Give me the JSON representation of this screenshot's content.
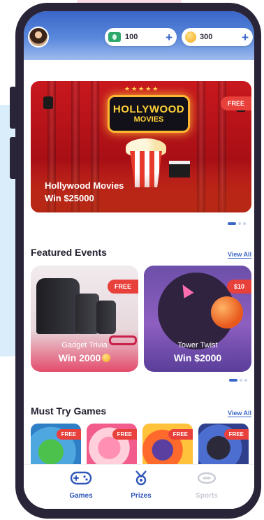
{
  "header": {
    "cash_balance": "100",
    "coin_balance": "300",
    "add_label": "+"
  },
  "banner": {
    "marquee_line1": "HOLLYWOOD",
    "marquee_line2": "MOVIES",
    "stars": "★★★★★",
    "tag": "FREE",
    "title": "Hollywood Movies",
    "prize": "Win $25000"
  },
  "featured": {
    "title": "Featured Events",
    "view_all": "View All",
    "events": [
      {
        "tag": "FREE",
        "name": "Gadget Trivia",
        "prize": "Win 2000"
      },
      {
        "tag": "$10",
        "name": "Tower Twist",
        "prize": "Win $2000"
      }
    ]
  },
  "must_try": {
    "title": "Must Try Games",
    "view_all": "View All",
    "games": [
      {
        "tag": "FREE"
      },
      {
        "tag": "FREE"
      },
      {
        "tag": "FREE"
      },
      {
        "tag": "FREE"
      }
    ]
  },
  "nav": {
    "items": [
      {
        "label": "Games",
        "icon": "gamepad-icon",
        "active": true
      },
      {
        "label": "Prizes",
        "icon": "medal-icon",
        "active": true
      },
      {
        "label": "Sports",
        "icon": "football-icon",
        "active": false
      }
    ]
  },
  "colors": {
    "primary": "#3a66c8",
    "tag_red": "#e8403b",
    "banner_red": "#c8181e",
    "phone_frame": "#2a2438"
  }
}
